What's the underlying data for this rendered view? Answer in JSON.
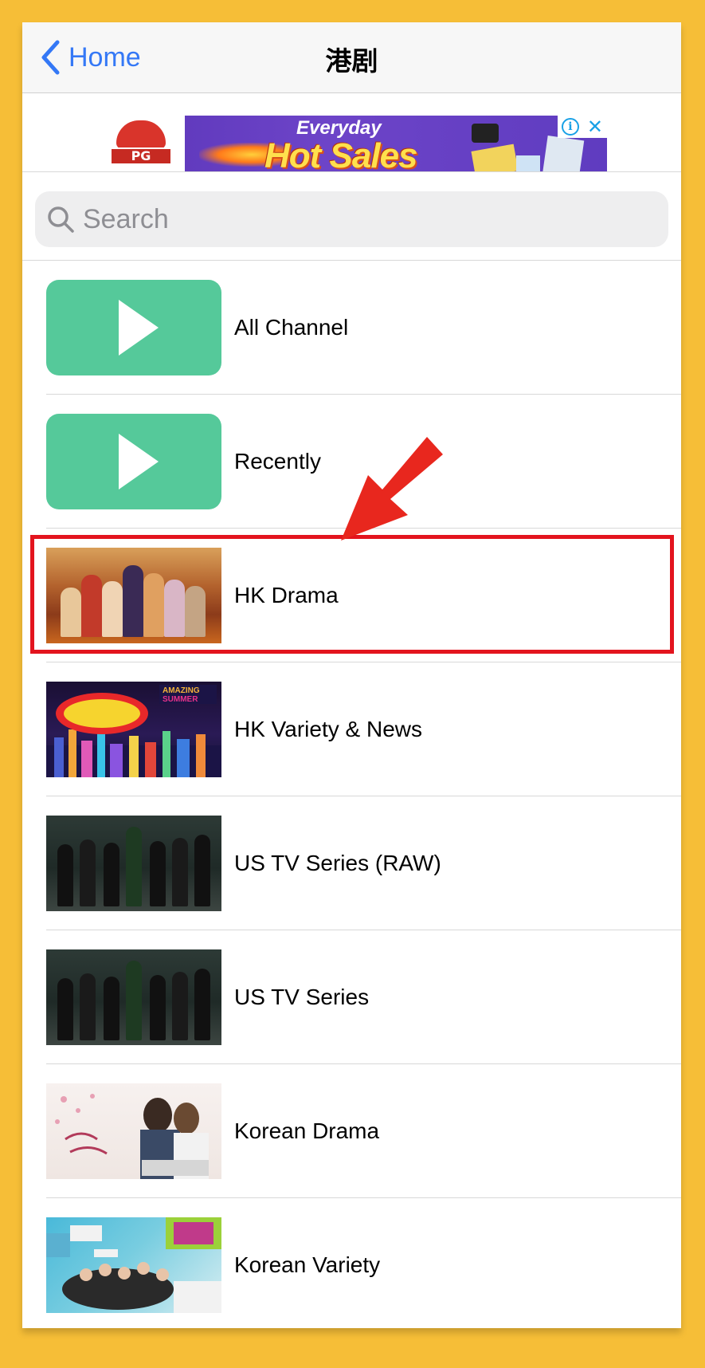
{
  "navbar": {
    "back_label": "Home",
    "title": "港剧"
  },
  "ad": {
    "brand": "PG MALL",
    "headline_small": "Everyday",
    "headline_big": "Hot Sales",
    "info_icon": "info-icon",
    "close_icon": "close-icon"
  },
  "search": {
    "placeholder": "Search",
    "value": ""
  },
  "list": {
    "items": [
      {
        "label": "All Channel",
        "thumb": "play-icon"
      },
      {
        "label": "Recently",
        "thumb": "play-icon"
      },
      {
        "label": "HK Drama",
        "thumb": "hk-drama-thumbnail"
      },
      {
        "label": "HK Variety & News",
        "thumb": "hk-variety-thumbnail"
      },
      {
        "label": "US TV Series (RAW)",
        "thumb": "us-series-thumbnail"
      },
      {
        "label": "US TV Series",
        "thumb": "us-series-thumbnail"
      },
      {
        "label": "Korean Drama",
        "thumb": "korean-drama-thumbnail"
      },
      {
        "label": "Korean Variety",
        "thumb": "korean-variety-thumbnail"
      }
    ]
  },
  "annotation": {
    "highlight_color": "#E3141E",
    "arrow_color": "#E8271E"
  },
  "colors": {
    "frame": "#F6BE37",
    "accent": "#3478F6",
    "play_tile": "#55C99A"
  }
}
